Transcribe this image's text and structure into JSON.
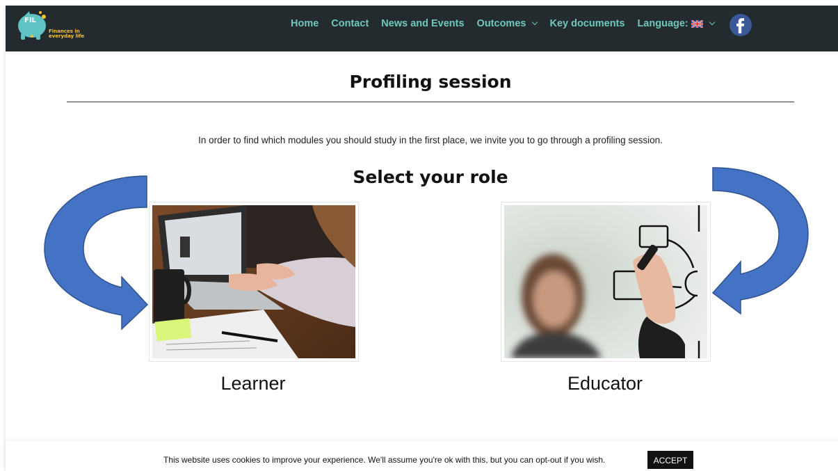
{
  "header": {
    "logo_text": "FIL",
    "logo_tagline": "Finances in everyday life",
    "nav": [
      {
        "label": "Home"
      },
      {
        "label": "Contact"
      },
      {
        "label": "News and Events"
      },
      {
        "label": "Outcomes"
      },
      {
        "label": "Key documents"
      },
      {
        "label": "Language:"
      }
    ]
  },
  "main": {
    "title": "Profiling session",
    "intro": "In order to find which modules you should study in the first place, we invite you to go through a profiling session.",
    "section_title": "Select your role",
    "roles": [
      {
        "label": "Learner"
      },
      {
        "label": "Educator"
      }
    ]
  },
  "cookie": {
    "text": "This website uses cookies to improve your experience. We'll assume you're ok with this, but you can opt-out if you wish.",
    "accept_label": "ACCEPT"
  },
  "colors": {
    "header_bg": "#232b2f",
    "nav_text": "#6fc9b9",
    "logo_teal": "#5fc4c3",
    "logo_yellow": "#f3c431",
    "arrow_blue": "#4472c4",
    "facebook_blue": "#3b5998"
  },
  "icons": [
    "piggy-logo-icon",
    "chevron-down-icon",
    "uk-flag-icon",
    "facebook-icon",
    "curved-arrow-icon"
  ]
}
